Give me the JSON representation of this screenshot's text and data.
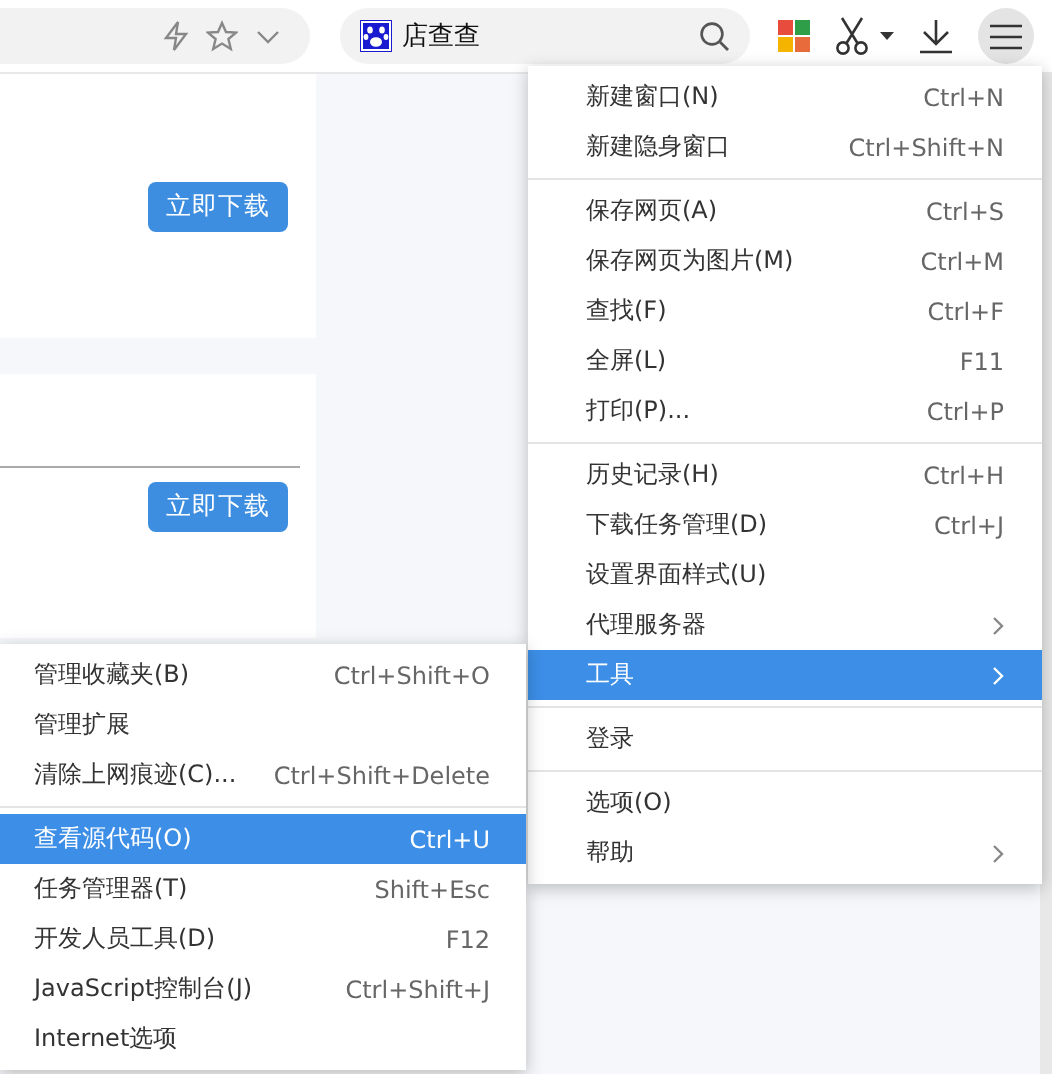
{
  "search_box": {
    "text": "店查查"
  },
  "page": {
    "cards": [
      {
        "button": "立即下载",
        "divider": false
      },
      {
        "button": "立即下载",
        "divider": true
      }
    ]
  },
  "main_menu": {
    "sections": [
      [
        {
          "label": "新建窗口(N)",
          "shortcut": "Ctrl+N",
          "submenu": false,
          "selected": false
        },
        {
          "label": "新建隐身窗口",
          "shortcut": "Ctrl+Shift+N",
          "submenu": false,
          "selected": false
        }
      ],
      [
        {
          "label": "保存网页(A)",
          "shortcut": "Ctrl+S",
          "submenu": false,
          "selected": false
        },
        {
          "label": "保存网页为图片(M)",
          "shortcut": "Ctrl+M",
          "submenu": false,
          "selected": false
        },
        {
          "label": "查找(F)",
          "shortcut": "Ctrl+F",
          "submenu": false,
          "selected": false
        },
        {
          "label": "全屏(L)",
          "shortcut": "F11",
          "submenu": false,
          "selected": false
        },
        {
          "label": "打印(P)...",
          "shortcut": "Ctrl+P",
          "submenu": false,
          "selected": false
        }
      ],
      [
        {
          "label": "历史记录(H)",
          "shortcut": "Ctrl+H",
          "submenu": false,
          "selected": false
        },
        {
          "label": "下载任务管理(D)",
          "shortcut": "Ctrl+J",
          "submenu": false,
          "selected": false
        },
        {
          "label": "设置界面样式(U)",
          "submenu": false,
          "selected": false
        },
        {
          "label": "代理服务器",
          "submenu": true,
          "selected": false
        },
        {
          "label": "工具",
          "submenu": true,
          "selected": true
        }
      ],
      [
        {
          "label": "登录",
          "submenu": false,
          "selected": false
        }
      ],
      [
        {
          "label": "选项(O)",
          "submenu": false,
          "selected": false
        },
        {
          "label": "帮助",
          "submenu": true,
          "selected": false
        }
      ]
    ]
  },
  "submenu": {
    "sections": [
      [
        {
          "label": "管理收藏夹(B)",
          "shortcut": "Ctrl+Shift+O",
          "selected": false
        },
        {
          "label": "管理扩展",
          "selected": false
        },
        {
          "label": "清除上网痕迹(C)...",
          "shortcut": "Ctrl+Shift+Delete",
          "selected": false
        }
      ],
      [
        {
          "label": "查看源代码(O)",
          "shortcut": "Ctrl+U",
          "selected": true
        },
        {
          "label": "任务管理器(T)",
          "shortcut": "Shift+Esc",
          "selected": false
        },
        {
          "label": "开发人员工具(D)",
          "shortcut": "F12",
          "selected": false
        },
        {
          "label": "JavaScript控制台(J)",
          "shortcut": "Ctrl+Shift+J",
          "selected": false
        },
        {
          "label": "Internet选项",
          "selected": false
        }
      ]
    ]
  }
}
